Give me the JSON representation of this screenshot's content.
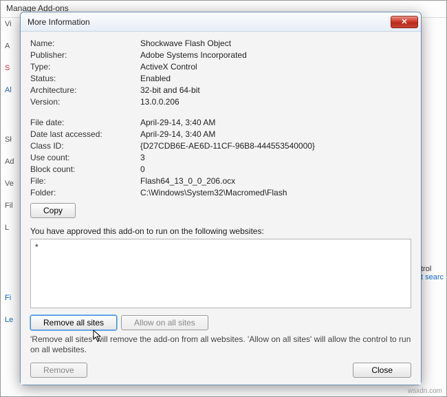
{
  "outer": {
    "title": "Manage Add-ons"
  },
  "dialog": {
    "title": "More Information",
    "close_symbol": "✕"
  },
  "info": {
    "name_label": "Name:",
    "name_value": "Shockwave Flash Object",
    "publisher_label": "Publisher:",
    "publisher_value": "Adobe Systems Incorporated",
    "type_label": "Type:",
    "type_value": "ActiveX Control",
    "status_label": "Status:",
    "status_value": "Enabled",
    "arch_label": "Architecture:",
    "arch_value": "32-bit and 64-bit",
    "version_label": "Version:",
    "version_value": "13.0.0.206",
    "filedate_label": "File date:",
    "filedate_value": "April-29-14, 3:40 AM",
    "accessed_label": "Date last accessed:",
    "accessed_value": "April-29-14, 3:40 AM",
    "classid_label": "Class ID:",
    "classid_value": "{D27CDB6E-AE6D-11CF-96B8-444553540000}",
    "usecount_label": "Use count:",
    "usecount_value": "3",
    "blockcount_label": "Block count:",
    "blockcount_value": "0",
    "file_label": "File:",
    "file_value": "Flash64_13_0_0_206.ocx",
    "folder_label": "Folder:",
    "folder_value": "C:\\Windows\\System32\\Macromed\\Flash"
  },
  "actions": {
    "copy": "Copy",
    "approve_text": "You have approved this add-on to run on the following websites:",
    "sites_content": "*",
    "remove_all": "Remove all sites",
    "allow_all": "Allow on all sites",
    "description": "'Remove all sites' will remove the add-on from all websites. 'Allow on all sites' will allow the control to run on all websites.",
    "remove": "Remove",
    "close": "Close"
  },
  "bg": {
    "frag_v": "Vi",
    "frag_a": "A",
    "frag_s": "S",
    "frag_al": "Al",
    "frag_sh": "Sł",
    "frag_ad": "Ad",
    "frag_ve": "Ve",
    "frag_fi": "Fil",
    "frag_l": "L",
    "frag_fi2": "Fi",
    "frag_le": "Le",
    "right_trol": "trol",
    "right_search": "t searc"
  },
  "watermark": "wsxdn.com"
}
